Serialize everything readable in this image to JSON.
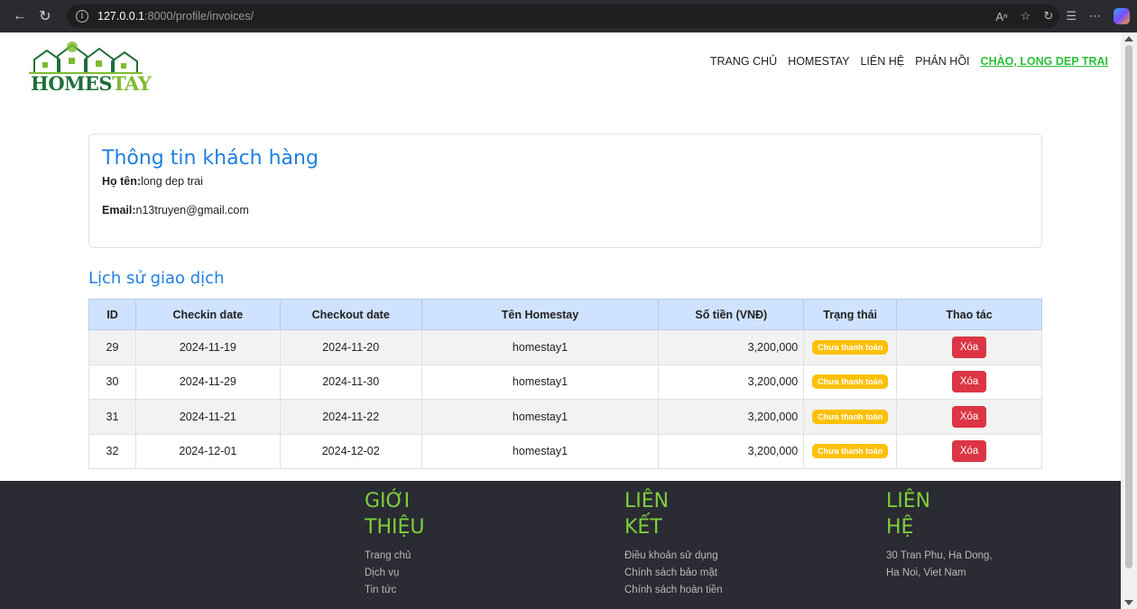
{
  "browser": {
    "url_host": "127.0.0.1",
    "url_path": ":8000/profile/invoices/"
  },
  "header": {
    "logo_text_a": "HOMES",
    "logo_text_b": "TAY",
    "nav": [
      "TRANG CHỦ",
      "HOMESTAY",
      "LIÊN HỆ",
      "PHẢN HỒI"
    ],
    "greeting": "CHÀO, LONG DEP TRAI"
  },
  "customer": {
    "title": "Thông tin khách hàng",
    "name_label": "Họ tên:",
    "name_value": "long dep trai",
    "email_label": "Email:",
    "email_value": "n13truyen@gmail.com"
  },
  "history": {
    "title": "Lịch sử giao dịch",
    "columns": [
      "ID",
      "Checkin date",
      "Checkout date",
      "Tên Homestay",
      "Số tiền (VNĐ)",
      "Trạng thái",
      "Thao tác"
    ],
    "rows": [
      {
        "id": "29",
        "checkin": "2024-11-19",
        "checkout": "2024-11-20",
        "homestay": "homestay1",
        "amount": "3,200,000",
        "status": "Chưa thanh toán",
        "action": "Xóa"
      },
      {
        "id": "30",
        "checkin": "2024-11-29",
        "checkout": "2024-11-30",
        "homestay": "homestay1",
        "amount": "3,200,000",
        "status": "Chưa thanh toán",
        "action": "Xóa"
      },
      {
        "id": "31",
        "checkin": "2024-11-21",
        "checkout": "2024-11-22",
        "homestay": "homestay1",
        "amount": "3,200,000",
        "status": "Chưa thanh toán",
        "action": "Xóa"
      },
      {
        "id": "32",
        "checkin": "2024-12-01",
        "checkout": "2024-12-02",
        "homestay": "homestay1",
        "amount": "3,200,000",
        "status": "Chưa thanh toán",
        "action": "Xóa"
      }
    ]
  },
  "footer": {
    "about": {
      "title": "GIỚI THIỆU",
      "items": [
        "Trang chủ",
        "Dịch vụ",
        "Tin tức"
      ]
    },
    "links": {
      "title": "LIÊN KẾT",
      "items": [
        "Điều khoản sử dụng",
        "Chính sách bảo mật",
        "Chính sách hoàn tiền"
      ]
    },
    "contact": {
      "title": "LIÊN HỆ",
      "items": [
        "30 Tran Phu, Ha Dong,",
        "Ha Noi, Viet Nam"
      ]
    }
  },
  "colors": {
    "accent_blue": "#1f7fe0",
    "footer_green": "#7fcf3b",
    "badge_yellow": "#ffc107",
    "danger_red": "#dc3545"
  }
}
